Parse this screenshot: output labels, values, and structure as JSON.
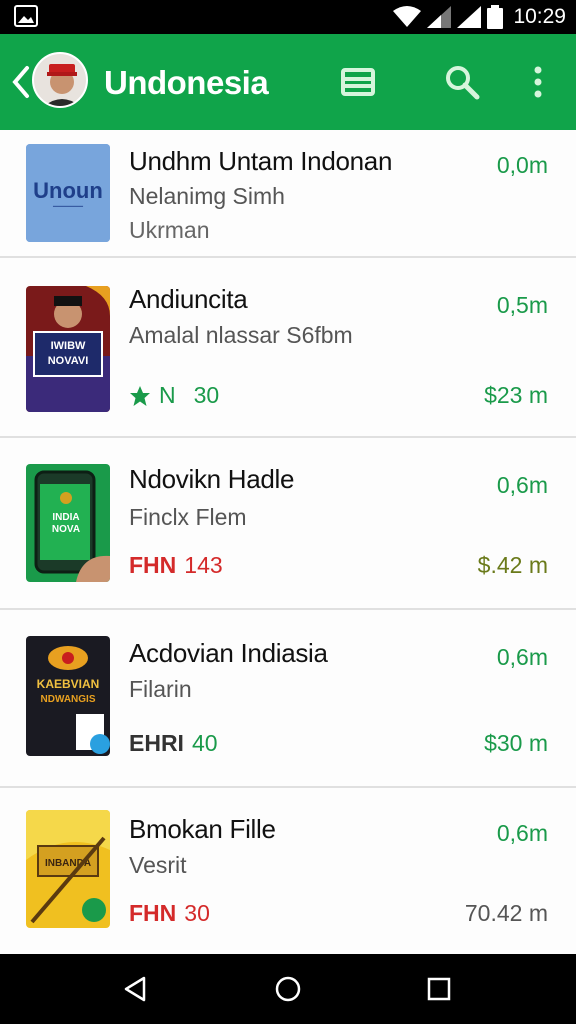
{
  "status_bar": {
    "time": "10:29"
  },
  "app_bar": {
    "title": "Undonesia"
  },
  "colors": {
    "accent": "#10a44a",
    "price_green": "#1a9a4a",
    "badge_red": "#d42a2a"
  },
  "items": [
    {
      "name": "Undhm Untam Indonan",
      "subtitle": "Nelanimg Simh",
      "subtitle2": "Ukrman",
      "size": "0,0m",
      "price": "",
      "badge_text": "",
      "badge_value": "",
      "thumb_text": "Unoun"
    },
    {
      "name": "Andiuncita",
      "subtitle": "Amalal nlassar S6fbm",
      "subtitle2": "",
      "size": "0,5m",
      "price": "$23 m",
      "badge_text": "N",
      "badge_value": "30",
      "thumb_text": "IWIBW NOVAVI"
    },
    {
      "name": "Ndovikn Hadle",
      "subtitle": "Finclx Flem",
      "subtitle2": "",
      "size": "0,6m",
      "price": "$.42 m",
      "badge_text": "FHN",
      "badge_value": "143",
      "thumb_text": "INDIA NOVA"
    },
    {
      "name": "Acdovian Indiasia",
      "subtitle": "Filarin",
      "subtitle2": "",
      "size": "0,6m",
      "price": "$30 m",
      "badge_text": "EHRI",
      "badge_value": "40",
      "thumb_text": "KAEBVIAN NDWANGIS"
    },
    {
      "name": "Bmokan Fille",
      "subtitle": "Vesrit",
      "subtitle2": "",
      "size": "0,6m",
      "price": "70.42 m",
      "badge_text": "FHN",
      "badge_value": "30",
      "thumb_text": "INBANDA"
    }
  ]
}
